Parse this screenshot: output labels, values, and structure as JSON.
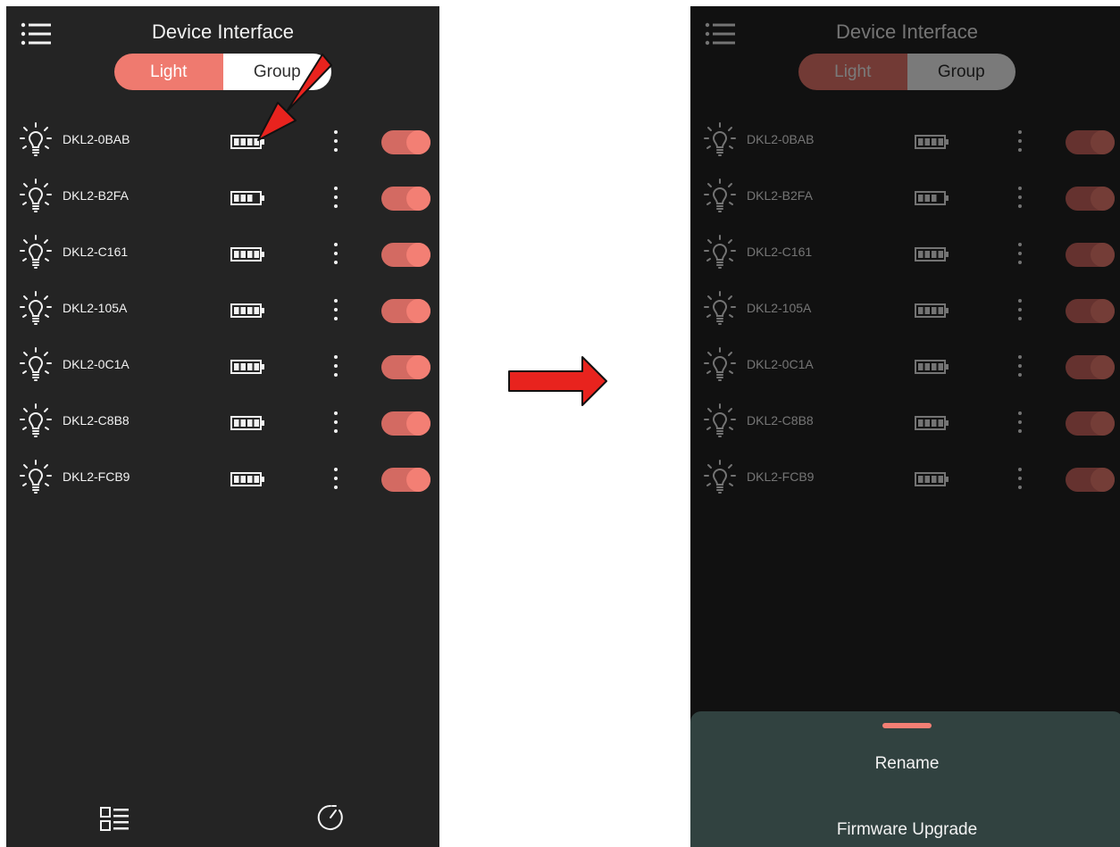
{
  "app": {
    "title": "Device Interface",
    "tabs": [
      {
        "label": "Light",
        "selected": true
      },
      {
        "label": "Group",
        "selected": false
      }
    ]
  },
  "devices": [
    {
      "name": "DKL2-0BAB",
      "battery_level": 1.0,
      "power_on": true
    },
    {
      "name": "DKL2-B2FA",
      "battery_level": 0.75,
      "power_on": true
    },
    {
      "name": "DKL2-C161",
      "battery_level": 1.0,
      "power_on": true
    },
    {
      "name": "DKL2-105A",
      "battery_level": 1.0,
      "power_on": true
    },
    {
      "name": "DKL2-0C1A",
      "battery_level": 1.0,
      "power_on": true
    },
    {
      "name": "DKL2-C8B8",
      "battery_level": 1.0,
      "power_on": true
    },
    {
      "name": "DKL2-FCB9",
      "battery_level": 1.0,
      "power_on": true
    }
  ],
  "bottom_nav": {
    "items": [
      {
        "icon": "list-layout-icon"
      },
      {
        "icon": "timer-icon"
      }
    ]
  },
  "bottom_sheet": {
    "items": [
      "Rename",
      "Firmware Upgrade"
    ]
  },
  "colors": {
    "accent": "#ef7a6f",
    "toggle_track": "#d36a62",
    "toggle_knob": "#f37f74",
    "background": "#242424",
    "sheet": "#314240",
    "annotation_arrow": "#e8231e"
  },
  "annotations": [
    {
      "icon": "pointer-arrow-icon",
      "points_to": "battery-icon of DKL2-0BAB"
    },
    {
      "icon": "transition-arrow-icon",
      "meaning": "leads to right screen"
    }
  ]
}
